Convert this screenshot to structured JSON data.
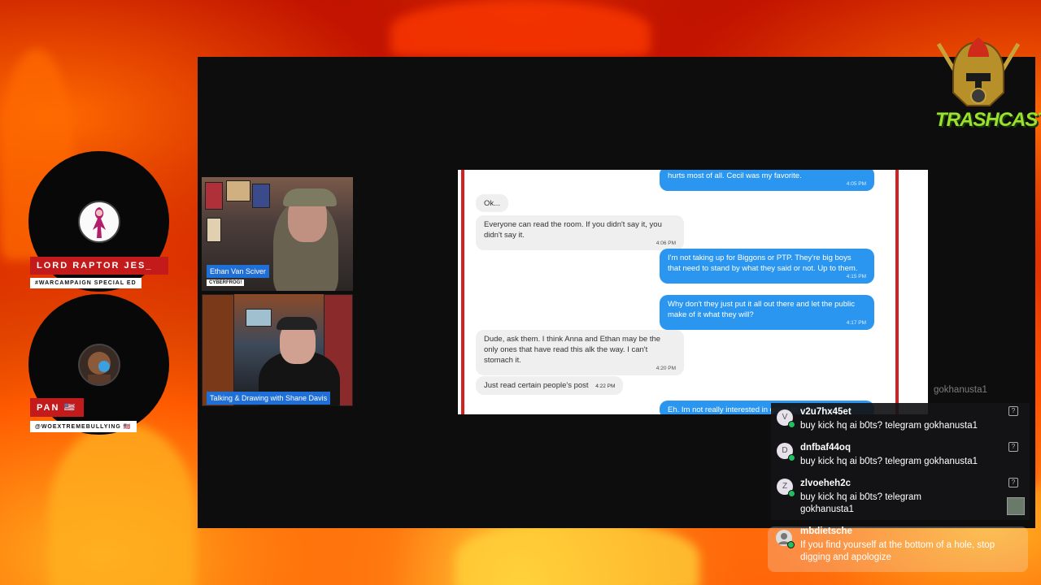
{
  "guests": [
    {
      "name": "LORD RAPTOR JES_",
      "tag": "#WARCAMPAIGN SPECIAL ED"
    },
    {
      "name": "PAN 🇺🇸",
      "tag": "@WOEXTREMEBULLYING 🇺🇸"
    }
  ],
  "cams": [
    {
      "name": "Ethan Van Sciver",
      "sub": "CYBERFROG!"
    },
    {
      "name": "Talking & Drawing with Shane Davis"
    }
  ],
  "shared_screen": {
    "messages": [
      {
        "dir": "out",
        "text": "hurts most of all. Cecil was my favorite.",
        "time": "4:05 PM"
      },
      {
        "dir": "in",
        "text": "Ok...",
        "time": ""
      },
      {
        "dir": "in",
        "text": "Everyone can read the room. If you didn't say it, you didn't say it.",
        "time": "4:06 PM"
      },
      {
        "dir": "out",
        "text": "I'm not taking up for Biggons or PTP. They're big boys that need to stand by what they said or not. Up to them.",
        "time": "4:15 PM"
      },
      {
        "dir": "out",
        "text": "Why don't they just put it all out there and let the public make of it what they will?",
        "time": "4:17 PM"
      },
      {
        "dir": "in",
        "text": "Dude, ask them. I think Anna and Ethan may be the only ones that have read this alk the way. I can't stomach it.",
        "time": "4:20 PM"
      },
      {
        "dir": "in",
        "text": "Just read certain people's post",
        "time": "4:22 PM"
      },
      {
        "dir": "out",
        "text": "Eh. Im not really interested in going to them",
        "time": ""
      }
    ]
  },
  "logo": {
    "text": "TRASHCAST"
  },
  "chat": {
    "faded_fragment": "gokhanusta1",
    "messages": [
      {
        "avatar": "V",
        "user": "v2u7hx45et",
        "text": "buy kick hq ai b0ts? telegram gokhanusta1"
      },
      {
        "avatar": "D",
        "user": "dnfbaf44oq",
        "text": "buy kick hq ai b0ts? telegram gokhanusta1"
      },
      {
        "avatar": "Z",
        "user": "zlvoeheh2c",
        "text": "buy kick hq ai b0ts? telegram gokhanusta1"
      },
      {
        "avatar": "",
        "user": "mbdietsche",
        "text": "If you find yourself at the bottom of a hole, stop digging and apologize"
      }
    ]
  },
  "colors": {
    "accent_red": "#c31b1b",
    "cam_label_blue": "#1f6fd6",
    "imessage_blue": "#2a96f0",
    "badge_green": "#20c060"
  }
}
